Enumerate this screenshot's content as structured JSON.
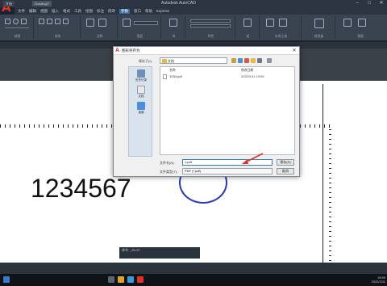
{
  "app": {
    "logo": "A",
    "window_title": "Autodesk AutoCAD",
    "window_controls": [
      "–",
      "□",
      "✕"
    ]
  },
  "menu": {
    "items": [
      "文件",
      "编辑",
      "视图",
      "插入",
      "格式",
      "工具",
      "绘图",
      "标注",
      "修改",
      "参数",
      "窗口",
      "帮助",
      "Express"
    ],
    "active_index": 9
  },
  "ribbon": {
    "groups": [
      "绘图",
      "修改",
      "注释",
      "图层",
      "块",
      "特性",
      "组",
      "实用工具",
      "剪贴板",
      "视图"
    ]
  },
  "file_tabs": {
    "tabs": [
      "开始",
      "Drawing1*"
    ]
  },
  "drawing": {
    "text": "1234567"
  },
  "dialog": {
    "title": "图形另存为",
    "lookin_label": "保存于(I):",
    "lookin_value": "文档",
    "places": [
      "历史记录",
      "文档",
      "桌面"
    ],
    "columns": {
      "name": "名称",
      "date": "修改日期"
    },
    "files": [
      {
        "name": "1234.pdf",
        "date": "2022/2/11 19:59"
      }
    ],
    "filename_label": "文件名(N):",
    "filename_value": "1.pdf",
    "filetype_label": "文件类型(T):",
    "filetype_value": "PDF (*.pdf)",
    "save_label": "保存(S)",
    "cancel_label": "取消"
  },
  "command_line": {
    "text": "命令: _PLOT"
  },
  "status": {
    "clock_time": "19:59",
    "clock_date": "2022/2/11"
  },
  "colors": {
    "accent": "#3a78c4",
    "autocad_red": "#e0302c",
    "circle_blue": "#2a38b8",
    "arrow_red": "#e0302c"
  }
}
